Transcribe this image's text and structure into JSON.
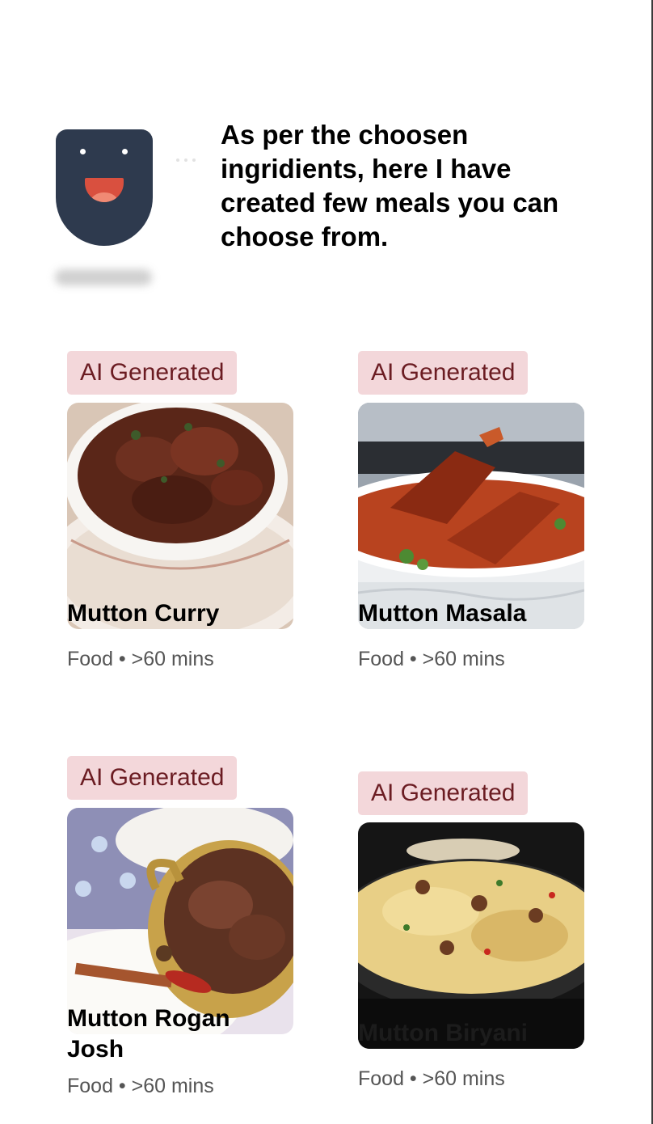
{
  "chat": {
    "message": "As per the choosen ingridients, here I have created few meals you can choose from."
  },
  "meals": [
    {
      "badge": "AI Generated",
      "title": "Mutton Curry",
      "meta": "Food • >60 mins"
    },
    {
      "badge": "AI Generated",
      "title": "Mutton Masala",
      "meta": "Food • >60 mins"
    },
    {
      "badge": "AI Generated",
      "title": "Mutton Rogan",
      "title_overflow": "Josh",
      "meta": "Food • >60 mins"
    },
    {
      "badge": "AI Generated",
      "title": "Mutton Biryani",
      "meta": "Food • >60 mins"
    }
  ],
  "colors": {
    "badge_bg": "#f3d7da",
    "badge_text": "#6b1c22",
    "mascot_body": "#2e3a4e",
    "mascot_mouth": "#d9503f"
  },
  "icons": [
    "mascot-avatar-icon",
    "typing-indicator-icon"
  ]
}
